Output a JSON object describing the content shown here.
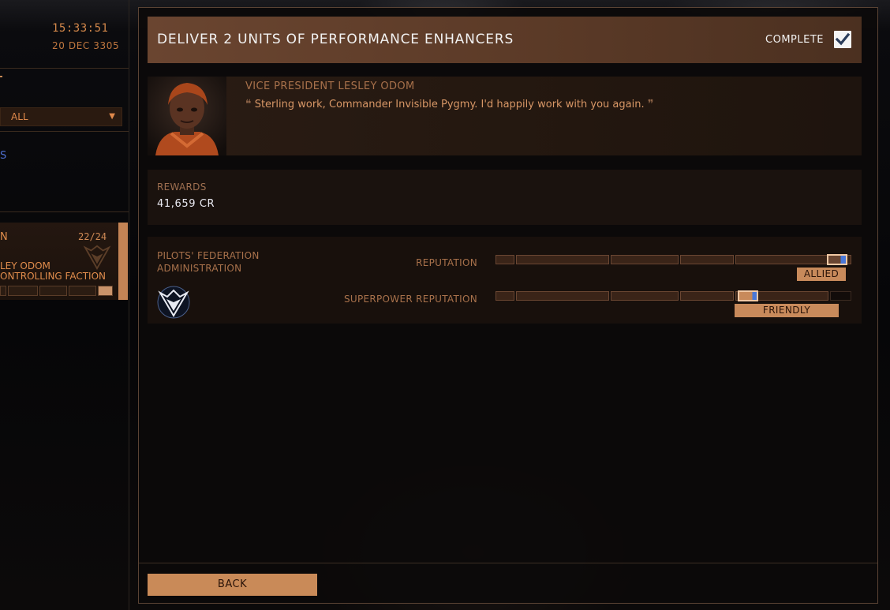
{
  "left_panel": {
    "time": "15:33:51",
    "date": "20 DEC 3305",
    "filter_value": "ALL",
    "filter_arrow_icon": "down-arrow-icon",
    "partial_header": "S",
    "mission_card": {
      "name_fragment": "N",
      "count": "22/24",
      "line1": "LEY ODOM",
      "line2": "ONTROLLING FACTION",
      "progress_fraction": 0.96
    }
  },
  "dialog": {
    "title": "DELIVER 2 UNITS OF PERFORMANCE ENHANCERS",
    "complete_label": "COMPLETE",
    "complete_checked": true,
    "giver": {
      "name": "VICE PRESIDENT LESLEY ODOM",
      "quote": "Sterling work, Commander Invisible Pygmy. I'd happily work with you again.",
      "open_quote_mark": "❝",
      "close_quote_mark": "❞"
    },
    "rewards": {
      "label": "REWARDS",
      "value": "41,659 CR"
    },
    "reputation": {
      "faction_name": "PILOTS' FEDERATION ADMINISTRATION",
      "faction_icon": "pilots-federation-icon",
      "rows": [
        {
          "label": "REPUTATION",
          "level": "ALLIED",
          "position": 0.98
        },
        {
          "label": "SUPERPOWER REPUTATION",
          "level": "FRIENDLY",
          "position": 0.73
        }
      ]
    },
    "back_label": "BACK"
  },
  "colors": {
    "accent_orange": "#c98a58",
    "text_orange": "#e08c4c",
    "title_bar": "#5b3a27",
    "progress_blue": "#4a78d8"
  }
}
